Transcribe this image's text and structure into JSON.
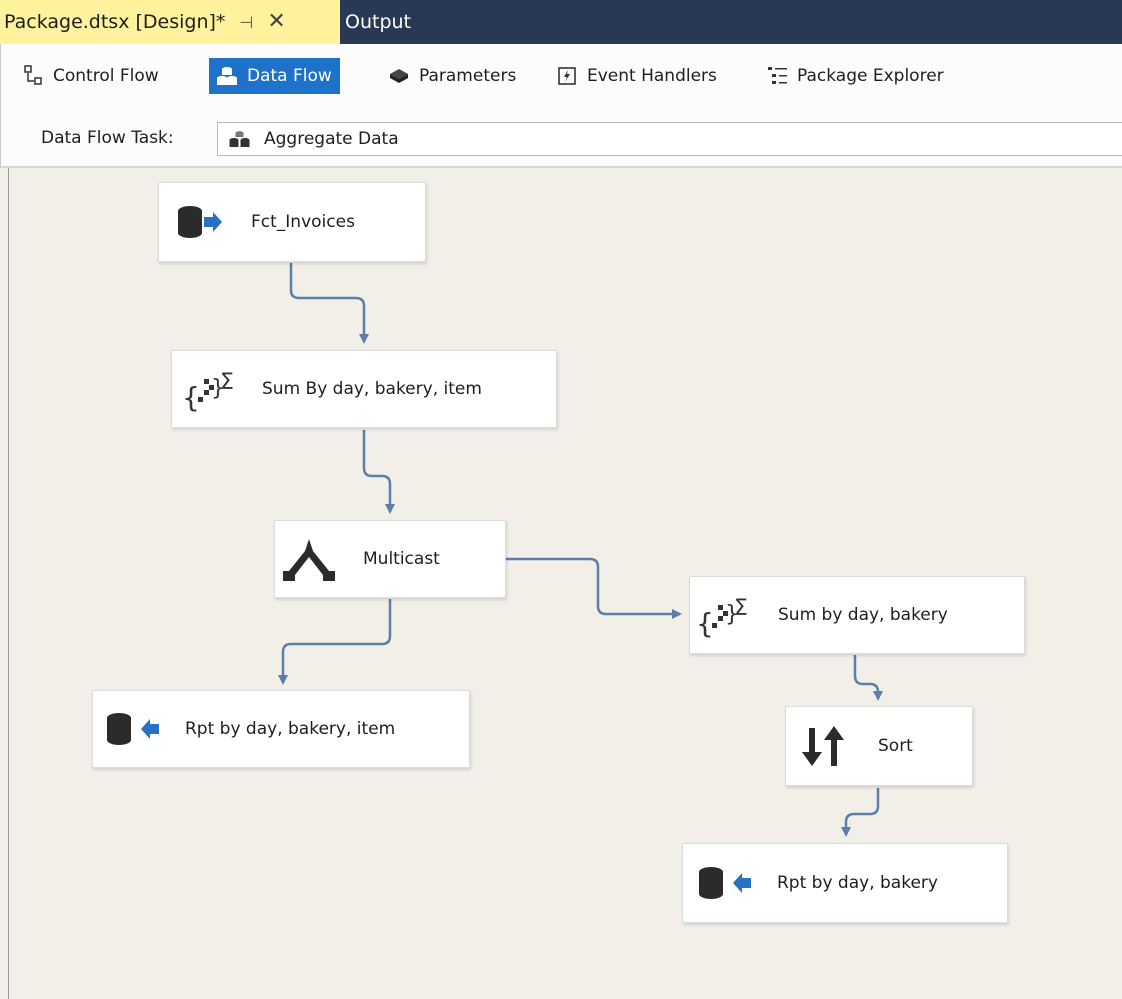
{
  "document_tabs": {
    "active": {
      "title": "Package.dtsx [Design]*",
      "pin_glyph": "⊣",
      "close_glyph": "✕"
    },
    "output": {
      "title": "Output"
    }
  },
  "designer_tabs": [
    {
      "label": "Control Flow",
      "icon": "control-flow-icon",
      "active": false
    },
    {
      "label": "Data Flow",
      "icon": "data-flow-icon",
      "active": true
    },
    {
      "label": "Parameters",
      "icon": "parameters-icon",
      "active": false
    },
    {
      "label": "Event Handlers",
      "icon": "event-handlers-icon",
      "active": false
    },
    {
      "label": "Package Explorer",
      "icon": "package-explorer-icon",
      "active": false
    }
  ],
  "task_selector": {
    "label": "Data Flow Task:",
    "value": "Aggregate Data",
    "icon": "data-flow-task-icon"
  },
  "components": {
    "source": {
      "label": "Fct_Invoices",
      "icon": "ole-db-source-icon"
    },
    "aggregate_item": {
      "label": "Sum By day, bakery, item",
      "icon": "aggregate-icon"
    },
    "multicast": {
      "label": "Multicast",
      "icon": "multicast-icon"
    },
    "aggregate_day": {
      "label": "Sum by day, bakery",
      "icon": "aggregate-icon"
    },
    "dest_item": {
      "label": "Rpt by day, bakery, item",
      "icon": "ole-db-destination-icon"
    },
    "sort": {
      "label": "Sort",
      "icon": "sort-icon"
    },
    "dest_day": {
      "label": "Rpt by day, bakery",
      "icon": "ole-db-destination-icon"
    }
  },
  "colors": {
    "tab_strip": "#293955",
    "active_doc_tab": "#fff29d",
    "active_designer_tab": "#1f72c9",
    "canvas": "#f2efe9",
    "connector": "#5b7fa8"
  }
}
